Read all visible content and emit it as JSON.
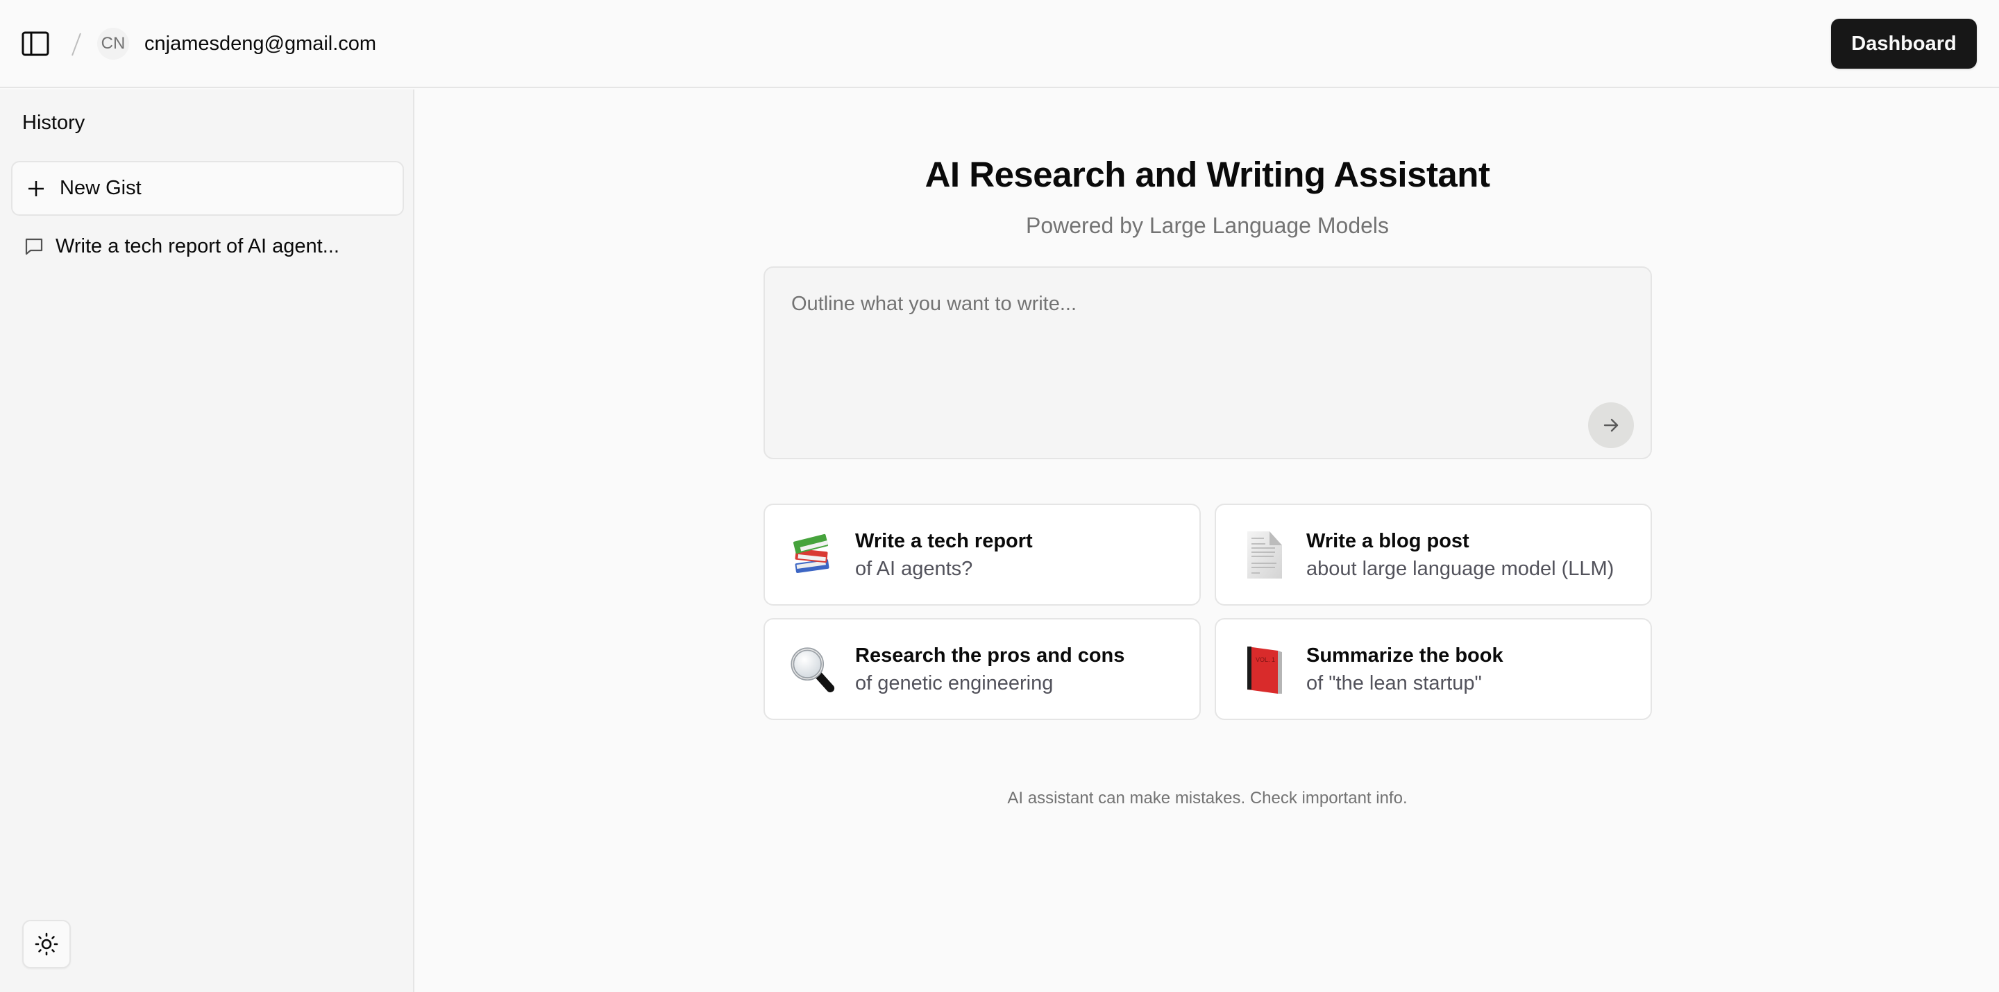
{
  "header": {
    "sidebar_toggle_icon": "panel-left-icon",
    "avatar_initials": "CN",
    "user_email": "cnjamesdeng@gmail.com",
    "dashboard_label": "Dashboard"
  },
  "sidebar": {
    "history_label": "History",
    "new_gist_label": "New Gist",
    "new_gist_icon": "plus-icon",
    "history_items": [
      {
        "label": "Write a tech report of AI agent...",
        "icon": "message-square-icon"
      }
    ],
    "theme_toggle_icon": "sun-icon"
  },
  "main": {
    "title": "AI Research and Writing Assistant",
    "subtitle": "Powered by Large Language Models",
    "prompt": {
      "value": "",
      "placeholder": "Outline what you want to write...",
      "send_icon": "arrow-right-icon"
    },
    "suggestions": [
      {
        "emoji": "📚",
        "icon": "books-icon",
        "title": "Write a tech report",
        "subtitle": "of AI agents?"
      },
      {
        "emoji": "📄",
        "icon": "page-facing-up-icon",
        "title": "Write a blog post",
        "subtitle": "about large language model (LLM)"
      },
      {
        "emoji": "🔍",
        "icon": "magnifying-glass-icon",
        "title": "Research the pros and cons",
        "subtitle": "of genetic engineering"
      },
      {
        "emoji": "📕",
        "icon": "closed-book-icon",
        "title": "Summarize the book",
        "subtitle": "of \"the lean startup\""
      }
    ],
    "disclaimer": "AI assistant can make mistakes. Check important info."
  },
  "colors": {
    "primary_button": "#171717",
    "background": "#fafafa",
    "sidebar_background": "#f5f5f5",
    "border": "#e5e5e5",
    "muted_text": "#737373"
  }
}
